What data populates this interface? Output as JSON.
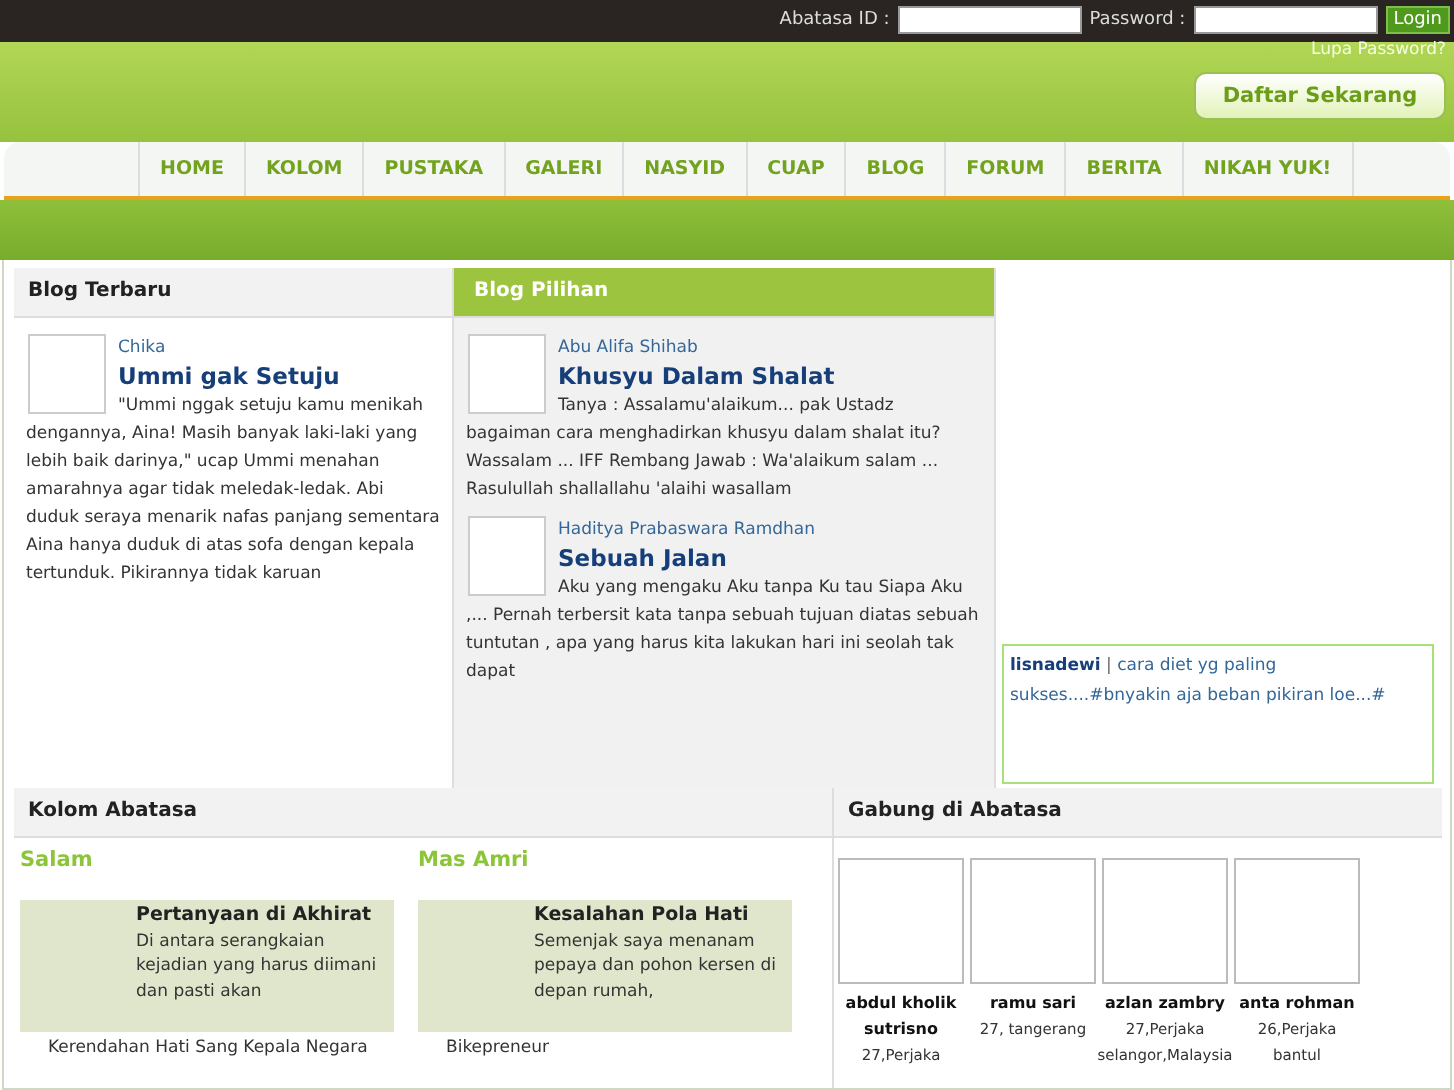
{
  "topbar": {
    "id_label": "Abatasa ID :",
    "password_label": "Password :",
    "login": "Login",
    "forgot": "Lupa Password?"
  },
  "header": {
    "register": "Daftar Sekarang"
  },
  "nav": [
    {
      "label": "HOME",
      "selected": false
    },
    {
      "label": "KOLOM",
      "selected": false
    },
    {
      "label": "PUSTAKA",
      "selected": false
    },
    {
      "label": "GALERI",
      "selected": false
    },
    {
      "label": "NASYID",
      "selected": false
    },
    {
      "label": "CUAP",
      "selected": false
    },
    {
      "label": "BLOG",
      "selected": false
    },
    {
      "label": "FORUM",
      "selected": false
    },
    {
      "label": "BERITA",
      "selected": false
    },
    {
      "label": "NIKAH YUK!",
      "selected": false
    }
  ],
  "blog_terbaru": {
    "title": "Blog Terbaru",
    "posts": [
      {
        "author": "Chika",
        "title": "Ummi gak Setuju",
        "excerpt": "\"Ummi nggak setuju kamu menikah dengannya, Aina! Masih banyak laki-laki yang lebih baik darinya,\" ucap Ummi menahan amarahnya agar tidak meledak-ledak. Abi duduk seraya menarik nafas panjang sementara Aina hanya duduk di atas sofa dengan kepala tertunduk. Pikirannya tidak karuan"
      }
    ]
  },
  "blog_pilihan": {
    "title": "Blog Pilihan",
    "posts": [
      {
        "author": "Abu Alifa Shihab",
        "title": "Khusyu Dalam Shalat",
        "excerpt": "Tanya : Assalamu'alaikum... pak Ustadz bagaiman cara menghadirkan khusyu dalam shalat itu? Wassalam ... IFF Rembang Jawab : Wa'alaikum salam ... Rasulullah shallallahu 'alaihi wasallam"
      },
      {
        "author": "Haditya Prabaswara Ramdhan",
        "title": "Sebuah Jalan",
        "excerpt": "Aku yang mengaku Aku tanpa Ku tau Siapa Aku ,... Pernah terbersit kata tanpa sebuah tujuan diatas sebuah tuntutan , apa yang harus kita lakukan hari ini seolah tak dapat"
      }
    ]
  },
  "cuap": {
    "user": "lisnadewi",
    "separator": "|",
    "text": "cara diet yg paling sukses....#bnyakin aja beban pikiran loe...#"
  },
  "kolom": {
    "title": "Kolom Abatasa",
    "columns": [
      {
        "author": "Salam",
        "title": "Pertanyaan di Akhirat",
        "excerpt": "Di antara serangkaian kejadian yang harus diimani dan pasti akan",
        "next": "Kerendahan Hati Sang Kepala Negara"
      },
      {
        "author": "Mas Amri",
        "title": "Kesalahan Pola Hati",
        "excerpt": "Semenjak saya menanam pepaya dan pohon kersen di depan rumah,",
        "next": "Bikepreneur"
      }
    ]
  },
  "gabung": {
    "title": "Gabung di Abatasa",
    "members": [
      {
        "name": "abdul kholik sutrisno",
        "info": "27,Perjaka"
      },
      {
        "name": "ramu sari",
        "info": "27, tangerang"
      },
      {
        "name": "azlan zambry",
        "info": "27,Perjaka selangor,Malaysia"
      },
      {
        "name": "anta rohman",
        "info": "26,Perjaka bantul"
      }
    ]
  }
}
